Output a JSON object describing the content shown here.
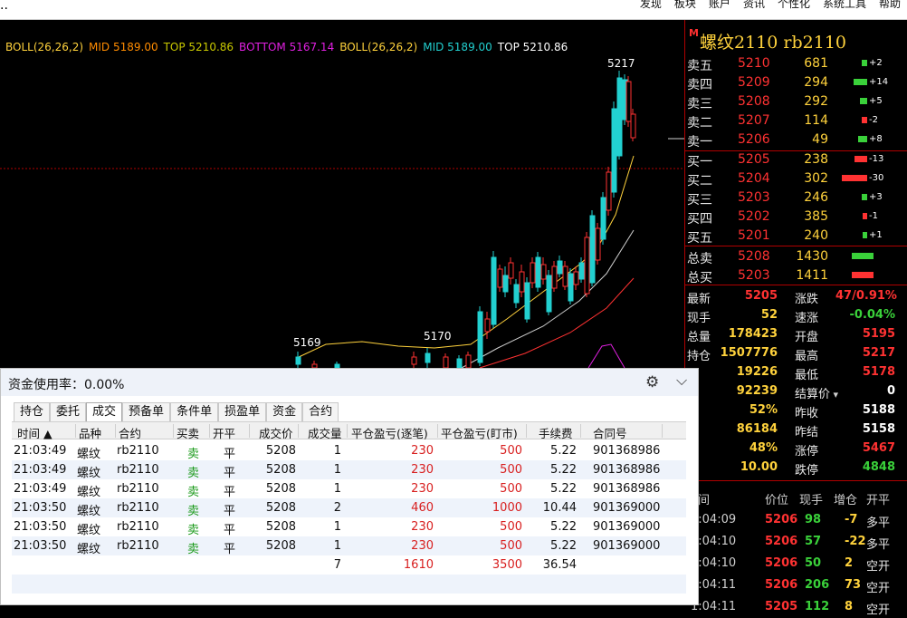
{
  "topbar": {
    "menu": [
      "发现",
      "板块",
      "账户",
      "资讯",
      "个性化",
      "系统工具",
      "帮助"
    ]
  },
  "colors": {
    "up": "#ff3232",
    "down": "#22d0d0",
    "yellow": "#ffd23c",
    "green": "#3ad13a",
    "magenta": "#e020e0",
    "orange": "#ff8c00"
  },
  "chart": {
    "boll": [
      {
        "text": "BOLL(26,26,2)",
        "color": "#ffd23c"
      },
      {
        "text": "MID 5189.00",
        "color": "#ff8c00"
      },
      {
        "text": "TOP 5210.86",
        "color": "#c8c800"
      },
      {
        "text": "BOTTOM 5167.14",
        "color": "#e020e0"
      },
      {
        "text": "BOLL(26,26,2)",
        "color": "#ffd23c"
      },
      {
        "text": "MID 5189.00",
        "color": "#22d0d0"
      },
      {
        "text": "TOP 5210.86",
        "color": "#ffffff"
      }
    ],
    "labels": {
      "high": "5217",
      "left": "5169",
      "mid": "5170"
    }
  },
  "quote": {
    "title": "螺纹2110  rb2110",
    "marker": "M",
    "asks": [
      {
        "label": "卖五",
        "price": "5210",
        "vol": "681",
        "chg": "+2"
      },
      {
        "label": "卖四",
        "price": "5209",
        "vol": "294",
        "chg": "+14"
      },
      {
        "label": "卖三",
        "price": "5208",
        "vol": "292",
        "chg": "+5"
      },
      {
        "label": "卖二",
        "price": "5207",
        "vol": "114",
        "chg": "-2"
      },
      {
        "label": "卖一",
        "price": "5206",
        "vol": "49",
        "chg": "+8"
      }
    ],
    "bids": [
      {
        "label": "买一",
        "price": "5205",
        "vol": "238",
        "chg": "-13"
      },
      {
        "label": "买二",
        "price": "5204",
        "vol": "302",
        "chg": "-30"
      },
      {
        "label": "买三",
        "price": "5203",
        "vol": "246",
        "chg": "+3"
      },
      {
        "label": "买四",
        "price": "5202",
        "vol": "385",
        "chg": "-1"
      },
      {
        "label": "买五",
        "price": "5201",
        "vol": "240",
        "chg": "+1"
      }
    ],
    "totals": [
      {
        "label": "总卖",
        "price": "5208",
        "vol": "1430"
      },
      {
        "label": "总买",
        "price": "5203",
        "vol": "1411"
      }
    ],
    "stats": [
      {
        "l1": "最新",
        "v1": "5205",
        "c1": "#ff3232",
        "l2": "涨跌",
        "v2": "47/0.91%",
        "c2": "#ff3232"
      },
      {
        "l1": "现手",
        "v1": "52",
        "c1": "#ffd23c",
        "l2": "速涨",
        "v2": "-0.04%",
        "c2": "#3ad13a"
      },
      {
        "l1": "总量",
        "v1": "178423",
        "c1": "#ffd23c",
        "l2": "开盘",
        "v2": "5195",
        "c2": "#ff3232"
      },
      {
        "l1": "持仓",
        "v1": "1507776",
        "c1": "#ffd23c",
        "l2": "最高",
        "v2": "5217",
        "c2": "#ff3232"
      },
      {
        "l1": "增",
        "v1": "19226",
        "c1": "#ffd23c",
        "l2": "最低",
        "v2": "5178",
        "c2": "#ff3232"
      },
      {
        "l1": "盘",
        "v1": "92239",
        "c1": "#ffd23c",
        "l2": "结算价",
        "v2": "0",
        "c2": "#ffffff"
      },
      {
        "l1": "例",
        "v1": "52%",
        "c1": "#ffd23c",
        "l2": "昨收",
        "v2": "5188",
        "c2": "#ffffff"
      },
      {
        "l1": "盘",
        "v1": "86184",
        "c1": "#ffd23c",
        "l2": "昨结",
        "v2": "5158",
        "c2": "#ffffff"
      },
      {
        "l1": "例",
        "v1": "48%",
        "c1": "#ffd23c",
        "l2": "涨停",
        "v2": "5467",
        "c2": "#ff3232"
      },
      {
        "l1": "杆",
        "v1": "10.00",
        "c1": "#ffd23c",
        "l2": "跌停",
        "v2": "4848",
        "c2": "#3ad13a"
      }
    ],
    "ticks_header": [
      "间",
      "价位",
      "现手",
      "增仓",
      "开平"
    ],
    "ticks": [
      {
        "time": "1:04:09",
        "price": "5206",
        "vol": "98",
        "oi": "-7",
        "kp": "多平"
      },
      {
        "time": "1:04:10",
        "price": "5206",
        "vol": "57",
        "oi": "-22",
        "kp": "多平"
      },
      {
        "time": "1:04:10",
        "price": "5206",
        "vol": "50",
        "oi": "2",
        "kp": "空开"
      },
      {
        "time": "1:04:11",
        "price": "5206",
        "vol": "206",
        "oi": "73",
        "kp": "空开"
      },
      {
        "time": "1:04:11",
        "price": "5205",
        "vol": "112",
        "oi": "8",
        "kp": "空开"
      }
    ]
  },
  "panel": {
    "title": "资金使用率：0.00%",
    "tabs": [
      "持仓",
      "委托",
      "成交",
      "预备单",
      "条件单",
      "损盈单",
      "资金",
      "合约"
    ],
    "active_tab": 2,
    "columns": [
      "时间 ▲",
      "品种",
      "合约",
      "买卖",
      "开平",
      "成交价",
      "成交量",
      "平仓盈亏(逐笔)",
      "平仓盈亏(盯市)",
      "手续费",
      "合同号"
    ],
    "rows": [
      [
        "21:03:49",
        "螺纹",
        "rb2110",
        "卖",
        "平",
        "5208",
        "1",
        "230",
        "500",
        "5.22",
        "901368986"
      ],
      [
        "21:03:49",
        "螺纹",
        "rb2110",
        "卖",
        "平",
        "5208",
        "1",
        "230",
        "500",
        "5.22",
        "901368986"
      ],
      [
        "21:03:49",
        "螺纹",
        "rb2110",
        "卖",
        "平",
        "5208",
        "1",
        "230",
        "500",
        "5.22",
        "901368986"
      ],
      [
        "21:03:50",
        "螺纹",
        "rb2110",
        "卖",
        "平",
        "5208",
        "2",
        "460",
        "1000",
        "10.44",
        "901369000"
      ],
      [
        "21:03:50",
        "螺纹",
        "rb2110",
        "卖",
        "平",
        "5208",
        "1",
        "230",
        "500",
        "5.22",
        "901369000"
      ],
      [
        "21:03:50",
        "螺纹",
        "rb2110",
        "卖",
        "平",
        "5208",
        "1",
        "230",
        "500",
        "5.22",
        "901369000"
      ]
    ],
    "summary": {
      "qty": "7",
      "pnl1": "1610",
      "pnl2": "3500",
      "fee": "36.54"
    }
  }
}
